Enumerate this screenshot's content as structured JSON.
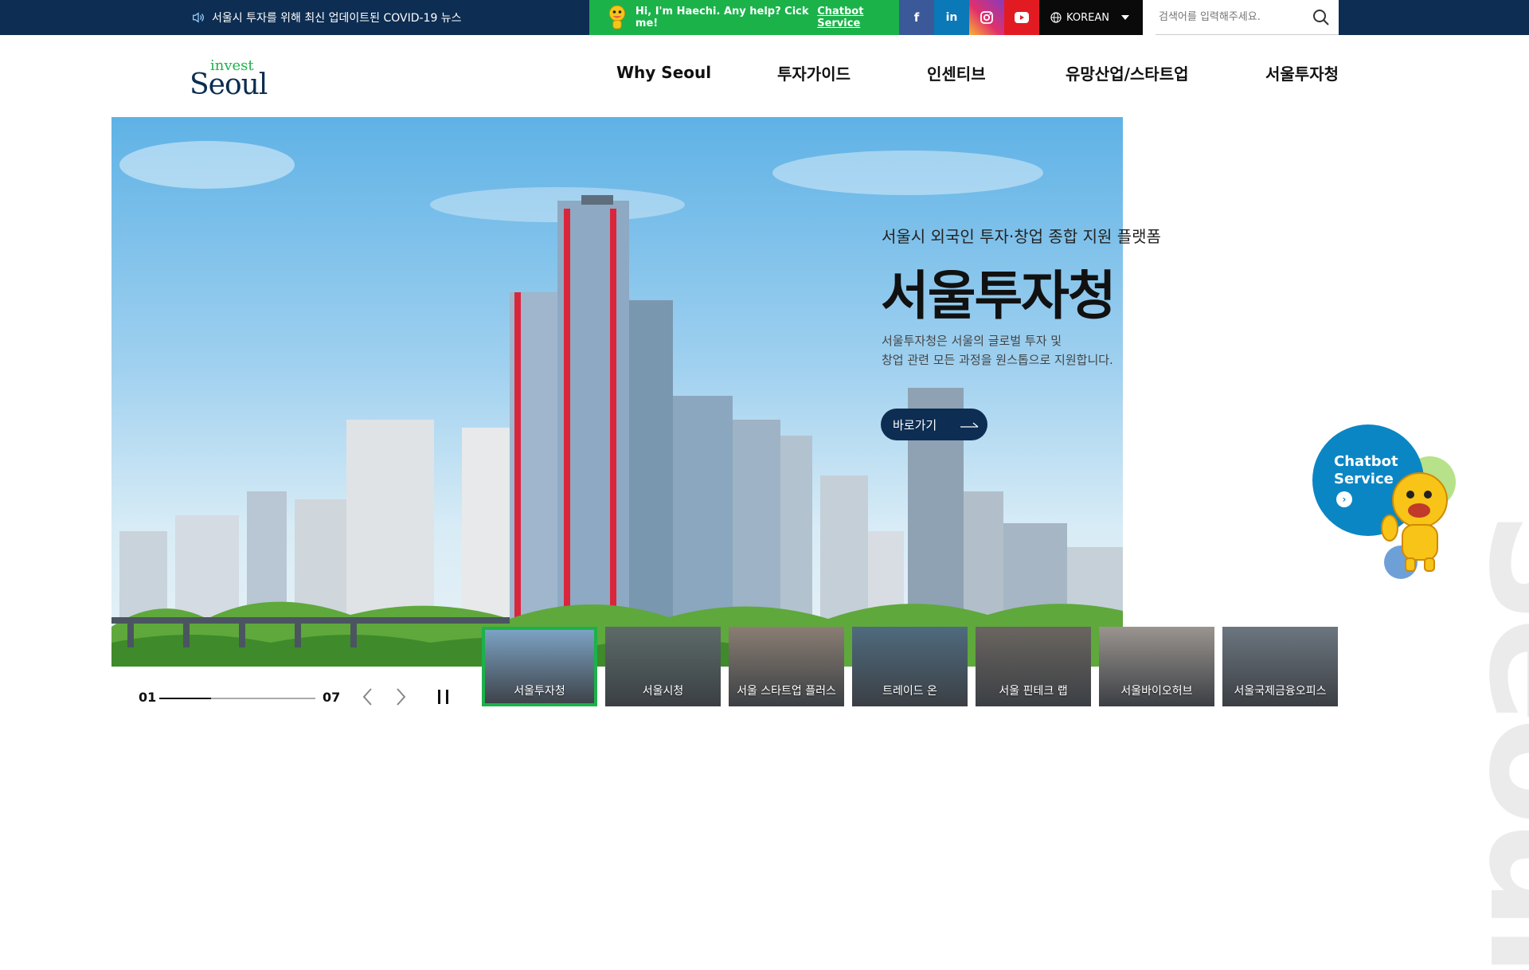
{
  "topbar": {
    "notice_text": "서울시 투자를 위해 최신 업데이트된 COVID-19 뉴스",
    "chatbot_greeting": "Hi, I'm Haechi. Any help? Cick me!",
    "chatbot_link": "Chatbot Service",
    "social": {
      "facebook": "f",
      "linkedin": "in"
    },
    "language": "KOREAN",
    "search_placeholder": "검색어를 입력해주세요."
  },
  "header": {
    "logo_small": "invest",
    "logo_big": "Seoul",
    "nav": [
      {
        "label": "Why Seoul"
      },
      {
        "label": "투자가이드"
      },
      {
        "label": "인센티브"
      },
      {
        "label": "유망산업/스타트업"
      },
      {
        "label": "서울투자청"
      }
    ]
  },
  "hero": {
    "subtitle": "서울시 외국인 투자·창업 종합 지원 플랫폼",
    "title": "서울투자청",
    "desc_line1": "서울투자청은 서울의 글로벌 투자 및",
    "desc_line2": "창업 관련 모든 과정을 원스톱으로 지원합니다.",
    "button": "바로가기"
  },
  "pager": {
    "current": "01",
    "total": "07",
    "progress": 0.33
  },
  "thumbnails": [
    {
      "label": "서울투자청",
      "color": "#7fa6c9",
      "active": true
    },
    {
      "label": "서울시청",
      "color": "#5c6b68",
      "active": false
    },
    {
      "label": "서울 스타트업 플러스",
      "color": "#8a7e73",
      "active": false
    },
    {
      "label": "트레이드 온",
      "color": "#4f6b7e",
      "active": false
    },
    {
      "label": "서울 핀테크 랩",
      "color": "#6a6560",
      "active": false
    },
    {
      "label": "서울바이오허브",
      "color": "#9a948f",
      "active": false
    },
    {
      "label": "서울국제금융오피스",
      "color": "#6c7680",
      "active": false
    }
  ],
  "floating_chatbot": {
    "line1": "Chatbot",
    "line2": "Service"
  },
  "colors": {
    "navy": "#0d2d52",
    "green": "#1bb24a",
    "chat_blue": "#0b86c4"
  }
}
